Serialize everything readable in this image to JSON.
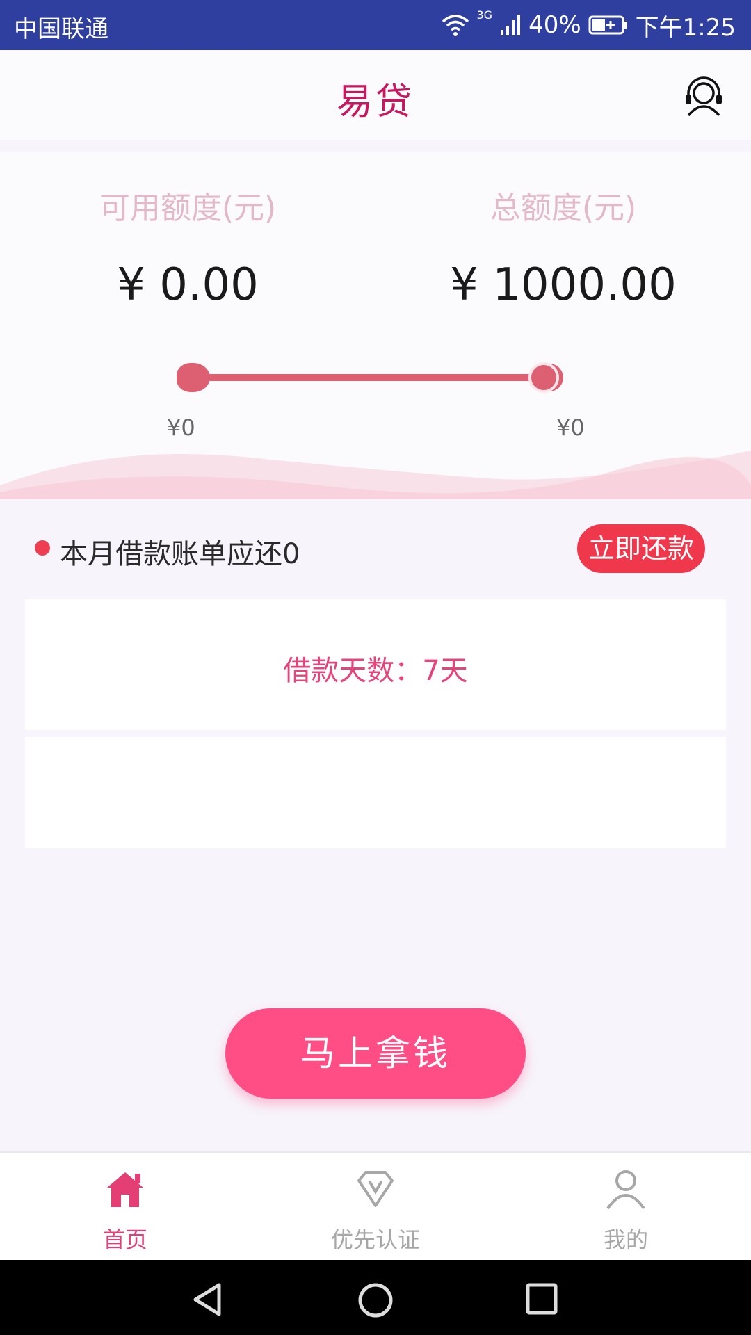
{
  "status_bar": {
    "carrier": "中国联通",
    "network": "3G",
    "battery": "40%",
    "time": "下午1:25"
  },
  "app_bar": {
    "title": "易贷",
    "support_icon": "customer-service-headset-icon"
  },
  "quota": {
    "available_label": "可用额度(元)",
    "available_value": "¥ 0.00",
    "total_label": "总额度(元)",
    "total_value": "¥ 1000.00",
    "slider_min_label": "¥0",
    "slider_max_label": "¥0"
  },
  "bill": {
    "text": "本月借款账单应还0",
    "repay_button": "立即还款"
  },
  "loan_days": "借款天数：7天",
  "cta": "马上拿钱",
  "bottom_nav": [
    {
      "label": "首页",
      "icon": "home-icon",
      "active": true
    },
    {
      "label": "优先认证",
      "icon": "diamond-v-icon",
      "active": false
    },
    {
      "label": "我的",
      "icon": "user-icon",
      "active": false
    }
  ],
  "colors": {
    "status_bar": "#2f3f9f",
    "brand": "#c6175f",
    "accent": "#ff4d85",
    "repay": "#f0384d"
  }
}
